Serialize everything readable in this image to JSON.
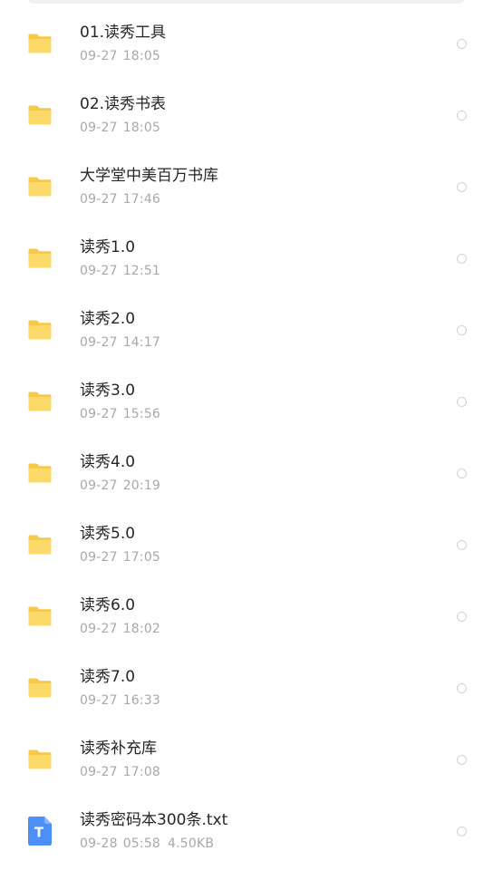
{
  "colors": {
    "folder_back": "#F6C94A",
    "folder_front": "#FBDA6A",
    "text_file": "#4E8EF7",
    "name_text": "#262626",
    "meta_text": "#A9A9A9"
  },
  "files": [
    {
      "name": "01.读秀工具",
      "date": "09-27",
      "time": "18:05",
      "icon": "folder-icon"
    },
    {
      "name": "02.读秀书表",
      "date": "09-27",
      "time": "18:05",
      "icon": "folder-icon"
    },
    {
      "name": "大学堂中美百万书库",
      "date": "09-27",
      "time": "17:46",
      "icon": "folder-icon"
    },
    {
      "name": "读秀1.0",
      "date": "09-27",
      "time": "12:51",
      "icon": "folder-icon"
    },
    {
      "name": "读秀2.0",
      "date": "09-27",
      "time": "14:17",
      "icon": "folder-icon"
    },
    {
      "name": "读秀3.0",
      "date": "09-27",
      "time": "15:56",
      "icon": "folder-icon"
    },
    {
      "name": "读秀4.0",
      "date": "09-27",
      "time": "20:19",
      "icon": "folder-icon"
    },
    {
      "name": "读秀5.0",
      "date": "09-27",
      "time": "17:05",
      "icon": "folder-icon"
    },
    {
      "name": "读秀6.0",
      "date": "09-27",
      "time": "18:02",
      "icon": "folder-icon"
    },
    {
      "name": "读秀7.0",
      "date": "09-27",
      "time": "16:33",
      "icon": "folder-icon"
    },
    {
      "name": "读秀补充库",
      "date": "09-27",
      "time": "17:08",
      "icon": "folder-icon"
    },
    {
      "name": "读秀密码本300条.txt",
      "date": "09-28",
      "time": "05:58",
      "size": "4.50KB",
      "icon": "text-file-icon",
      "icon_letter": "T"
    }
  ]
}
